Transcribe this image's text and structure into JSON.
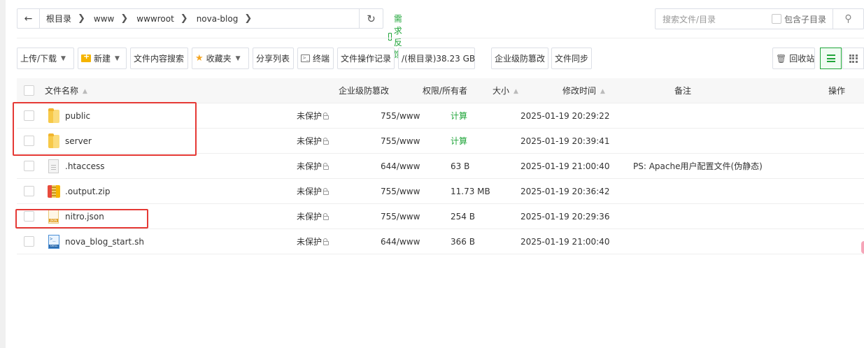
{
  "breadcrumb": {
    "back_icon": "arrow-left-icon",
    "segments": [
      "根目录",
      "www",
      "wwwroot",
      "nova-blog"
    ],
    "refresh_icon": "refresh-icon"
  },
  "feedback_label": "需求反馈",
  "search": {
    "placeholder": "搜索文件/目录",
    "include_sub_label": "包含子目录",
    "search_icon": "search-icon"
  },
  "toolbar": {
    "upload_download": "上传/下载",
    "new": "新建",
    "content_search": "文件内容搜索",
    "favorites": "收藏夹",
    "share_list": "分享列表",
    "terminal": "终端",
    "op_log": "文件操作记录",
    "disk": "/(根目录)38.23 GB",
    "tamper_proof": "企业级防篡改",
    "sync": "文件同步",
    "recycle_bin": "回收站"
  },
  "accent_color": "#20a53a",
  "table": {
    "headers": {
      "name": "文件名称",
      "tamper": "企业级防篡改",
      "perm": "权限/所有者",
      "size": "大小",
      "mtime": "修改时间",
      "note": "备注",
      "action": "操作"
    },
    "rows": [
      {
        "name": "public",
        "icon": "folder-icon",
        "protect": "未保护",
        "perm": "755/www",
        "size": "计算",
        "mtime": "2025-01-19 20:29:22",
        "note": ""
      },
      {
        "name": "server",
        "icon": "folder-icon",
        "protect": "未保护",
        "perm": "755/www",
        "size": "计算",
        "mtime": "2025-01-19 20:39:41",
        "note": ""
      },
      {
        "name": ".htaccess",
        "icon": "file-icon",
        "protect": "未保护",
        "perm": "644/www",
        "size": "63 B",
        "mtime": "2025-01-19 21:00:40",
        "note": "PS: Apache用户配置文件(伪静态)"
      },
      {
        "name": ".output.zip",
        "icon": "zip-icon",
        "protect": "未保护",
        "perm": "755/www",
        "size": "11.73 MB",
        "mtime": "2025-01-19 20:36:42",
        "note": ""
      },
      {
        "name": "nitro.json",
        "icon": "json-icon",
        "protect": "未保护",
        "perm": "755/www",
        "size": "254 B",
        "mtime": "2025-01-19 20:29:36",
        "note": ""
      },
      {
        "name": "nova_blog_start.sh",
        "icon": "shell-icon",
        "protect": "未保护",
        "perm": "644/www",
        "size": "366 B",
        "mtime": "2025-01-19 21:00:40",
        "note": ""
      }
    ]
  }
}
